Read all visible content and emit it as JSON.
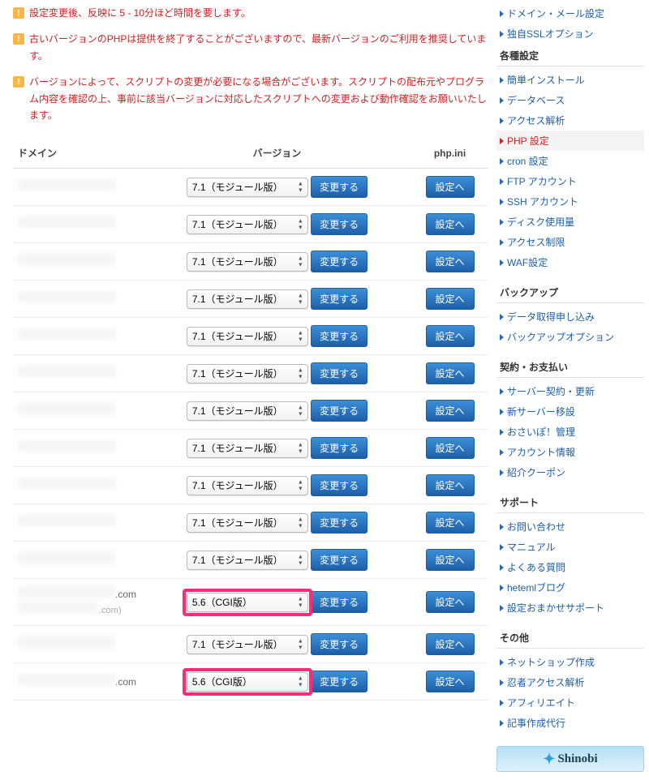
{
  "notices": [
    "設定変更後、反映に 5 - 10分ほど時間を要します。",
    "古いバージョンのPHPは提供を終了することがございますので、最新バージョンのご利用を推奨しています。",
    "バージョンによって、スクリプトの変更が必要になる場合がございます。スクリプトの配布元やプログラム内容を確認の上、事前に該当バージョンに対応したスクリプトへの変更および動作確認をお願いいたします。"
  ],
  "table": {
    "headers": {
      "domain": "ドメイン",
      "version": "バージョン",
      "ini": "php.ini"
    },
    "change_label": "変更する",
    "setting_label": "設定へ",
    "rows": [
      {
        "domain_visible": "",
        "domain_suffix": "",
        "version": "7.1（モジュール版）",
        "highlight": false
      },
      {
        "domain_visible": "",
        "domain_suffix": "",
        "version": "7.1（モジュール版）",
        "highlight": false
      },
      {
        "domain_visible": "",
        "domain_suffix": "",
        "version": "7.1（モジュール版）",
        "highlight": false
      },
      {
        "domain_visible": "",
        "domain_suffix": "",
        "version": "7.1（モジュール版）",
        "highlight": false
      },
      {
        "domain_visible": "",
        "domain_suffix": "",
        "version": "7.1（モジュール版）",
        "highlight": false
      },
      {
        "domain_visible": "",
        "domain_suffix": "",
        "version": "7.1（モジュール版）",
        "highlight": false
      },
      {
        "domain_visible": "",
        "domain_suffix": "",
        "version": "7.1（モジュール版）",
        "highlight": false
      },
      {
        "domain_visible": "",
        "domain_suffix": "",
        "version": "7.1（モジュール版）",
        "highlight": false
      },
      {
        "domain_visible": "",
        "domain_suffix": "",
        "version": "7.1（モジュール版）",
        "highlight": false
      },
      {
        "domain_visible": "",
        "domain_suffix": "",
        "version": "7.1（モジュール版）",
        "highlight": false
      },
      {
        "domain_visible": "",
        "domain_suffix": "",
        "version": "7.1（モジュール版）",
        "highlight": false
      },
      {
        "domain_visible": ".com",
        "domain_suffix": ".com)",
        "version": "5.6（CGI版）",
        "highlight": true
      },
      {
        "domain_visible": "",
        "domain_suffix": "",
        "version": "7.1（モジュール版）",
        "highlight": false
      },
      {
        "domain_visible": ".com",
        "domain_suffix": "",
        "version": "5.6（CGI版）",
        "highlight": true
      }
    ]
  },
  "sidebar": {
    "top_items": [
      "ドメイン・メール設定",
      "独自SSLオプション"
    ],
    "groups": [
      {
        "heading": "各種設定",
        "items": [
          {
            "label": "簡単インストール",
            "active": false
          },
          {
            "label": "データベース",
            "active": false
          },
          {
            "label": "アクセス解析",
            "active": false
          },
          {
            "label": "PHP 設定",
            "active": true
          },
          {
            "label": "cron 設定",
            "active": false
          },
          {
            "label": "FTP アカウント",
            "active": false
          },
          {
            "label": "SSH アカウント",
            "active": false
          },
          {
            "label": "ディスク使用量",
            "active": false
          },
          {
            "label": "アクセス制限",
            "active": false
          },
          {
            "label": "WAF設定",
            "active": false
          }
        ]
      },
      {
        "heading": "バックアップ",
        "items": [
          {
            "label": "データ取得申し込み",
            "active": false
          },
          {
            "label": "バックアップオプション",
            "active": false
          }
        ]
      },
      {
        "heading": "契約・お支払い",
        "items": [
          {
            "label": "サーバー契約・更新",
            "active": false
          },
          {
            "label": "新サーバー移設",
            "active": false
          },
          {
            "label": "おさいぽ！管理",
            "active": false
          },
          {
            "label": "アカウント情報",
            "active": false
          },
          {
            "label": "紹介クーポン",
            "active": false
          }
        ]
      },
      {
        "heading": "サポート",
        "items": [
          {
            "label": "お問い合わせ",
            "active": false
          },
          {
            "label": "マニュアル",
            "active": false
          },
          {
            "label": "よくある質問",
            "active": false
          },
          {
            "label": "hetemlブログ",
            "active": false
          },
          {
            "label": "設定おまかせサポート",
            "active": false
          }
        ]
      },
      {
        "heading": "その他",
        "items": [
          {
            "label": "ネットショップ作成",
            "active": false
          },
          {
            "label": "忍者アクセス解析",
            "active": false
          },
          {
            "label": "アフィリエイト",
            "active": false
          },
          {
            "label": "記事作成代行",
            "active": false
          }
        ]
      }
    ],
    "banner_label": "Shinobi"
  }
}
